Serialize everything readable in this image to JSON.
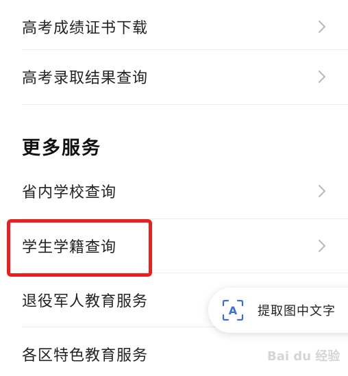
{
  "top_items": [
    {
      "label": "高考成绩证书下载"
    },
    {
      "label": "高考录取结果查询"
    }
  ],
  "more_services": {
    "title": "更多服务",
    "items": [
      {
        "label": "省内学校查询"
      },
      {
        "label": "学生学籍查询"
      },
      {
        "label": "退役军人教育服务"
      },
      {
        "label": "各区特色教育服务"
      }
    ]
  },
  "ocr_button": {
    "label": "提取图中文字",
    "icon_letter": "A"
  },
  "watermark": {
    "text": "Bai du 经验"
  },
  "colors": {
    "highlight": "#ea1f1f",
    "accent_blue": "#3b6fd8"
  }
}
